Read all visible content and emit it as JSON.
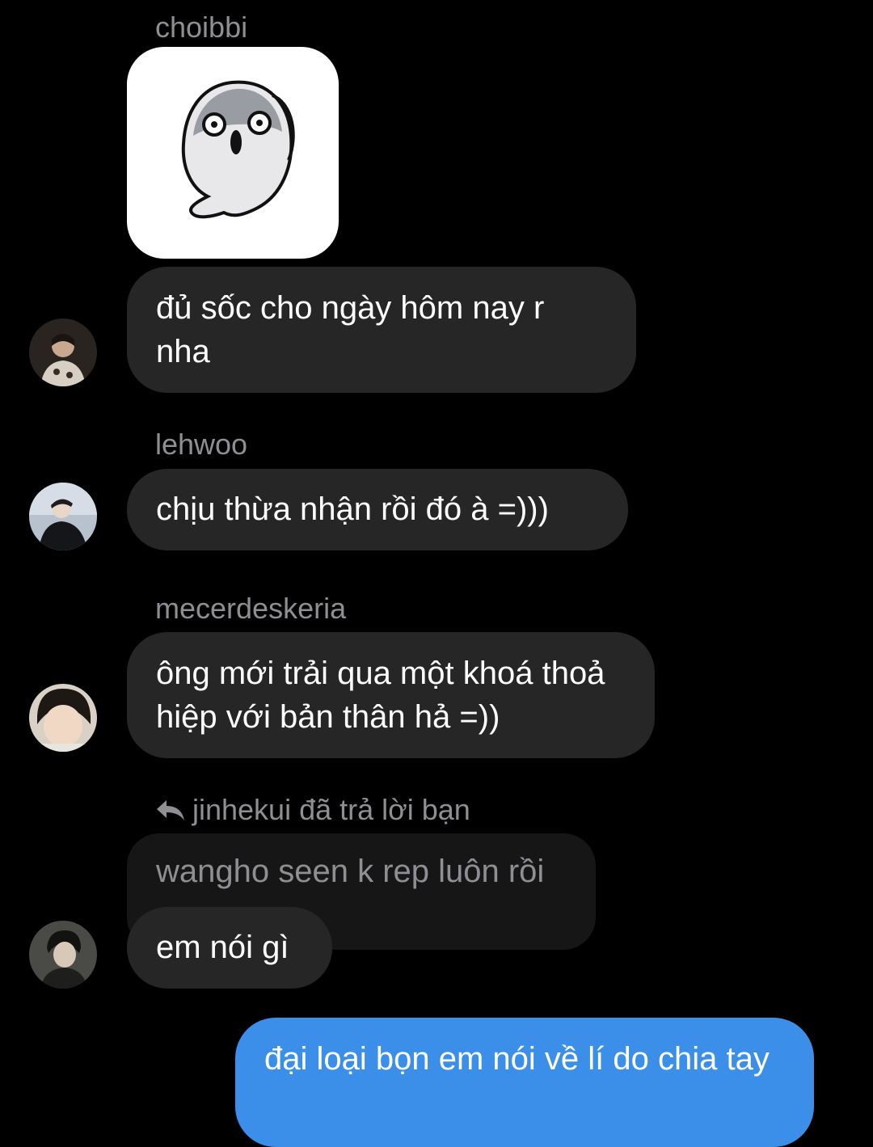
{
  "messages": {
    "m1": {
      "sender": "choibbi",
      "sticker_icon": "surprised-ghost-sticker",
      "text": "đủ sốc cho ngày hôm nay r nha"
    },
    "m2": {
      "sender": "lehwoo",
      "text": "chịu thừa nhận rồi đó à =)))"
    },
    "m3": {
      "sender": "mecerdeskeria",
      "text": "ông mới trải qua một khoá thoả hiệp với bản thân hả =))"
    },
    "m4": {
      "reply_label": "jinhekui đã trả lời bạn",
      "quoted_text": "wangho seen k rep luôn rồi",
      "text": "em nói gì"
    },
    "m5": {
      "text": "đại loại bọn em nói về lí do chia tay"
    }
  },
  "colors": {
    "background": "#000000",
    "incoming_bubble": "#262626",
    "outgoing_bubble": "#3b8fe8",
    "muted_text": "#8e8e93"
  }
}
